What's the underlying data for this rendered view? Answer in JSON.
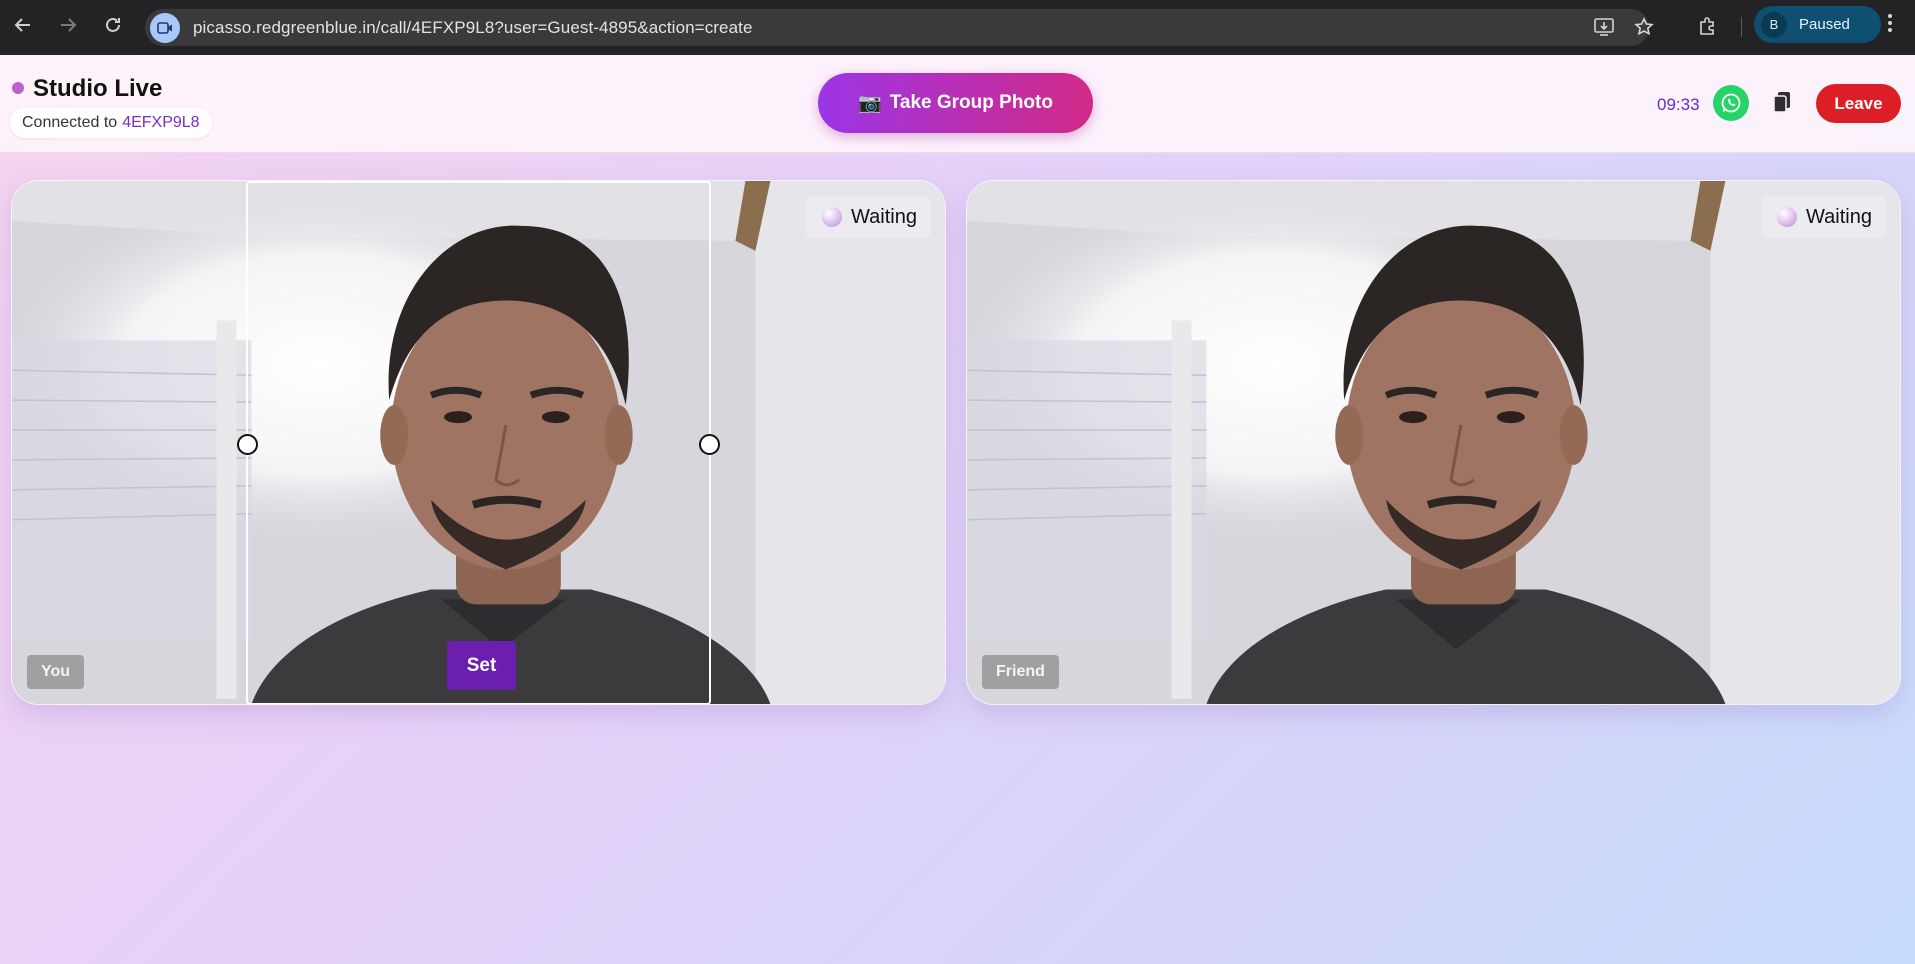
{
  "browser": {
    "url": "picasso.redgreenblue.in/call/4EFXP9L8?user=Guest-4895&action=create",
    "profile_initial": "B",
    "profile_status": "Paused",
    "icons": [
      "back-icon",
      "forward-icon",
      "reload-icon",
      "site-camera-icon",
      "install-app-icon",
      "bookmark-star-icon",
      "extensions-icon",
      "menu-kebab-icon"
    ]
  },
  "header": {
    "title": "Studio Live",
    "connected_label": "Connected to",
    "room_code": "4EFXP9L8",
    "take_photo_label": "Take Group Photo",
    "take_photo_icon": "📷",
    "timer": "09:33",
    "leave_label": "Leave"
  },
  "tiles": [
    {
      "name": "You",
      "status": "Waiting",
      "set_label": "Set"
    },
    {
      "name": "Friend",
      "status": "Waiting"
    }
  ],
  "colors": {
    "accent_purple": "#6b1fae",
    "gradient_start": "#9b35e6",
    "gradient_end": "#d22a86",
    "leave_red": "#dc1f26",
    "whatsapp_green": "#25d366"
  }
}
